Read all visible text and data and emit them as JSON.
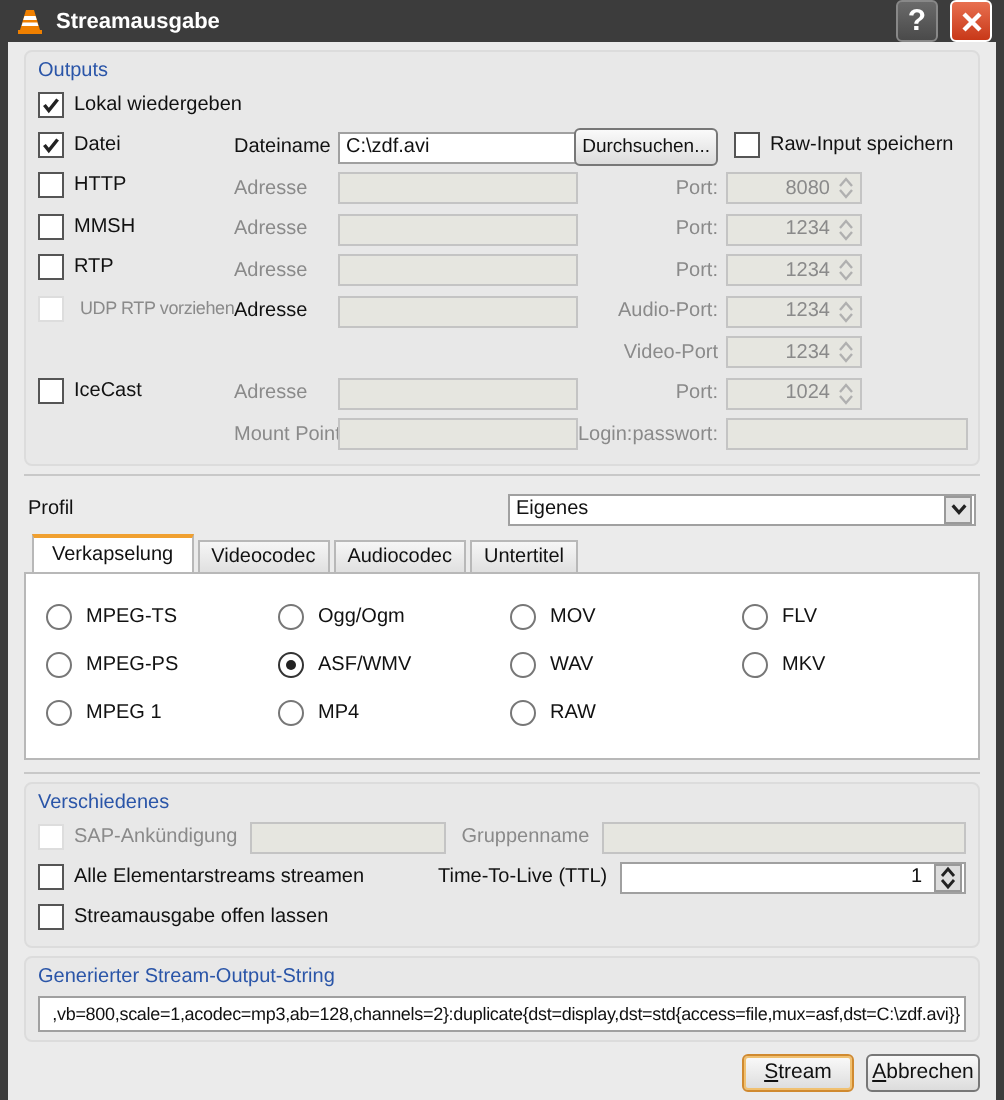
{
  "window": {
    "title": "Streamausgabe",
    "help": "?"
  },
  "outputs": {
    "title": "Outputs",
    "rows": [
      {
        "check": {
          "label": "Lokal wiedergeben",
          "checked": true,
          "disabled": false
        }
      },
      {
        "check": {
          "label": "Datei",
          "checked": true,
          "disabled": false
        },
        "label": {
          "text": "Dateiname",
          "disabled": false
        },
        "field": {
          "value": "C:\\zdf.avi",
          "disabled": false
        },
        "button": "Durchsuchen...",
        "side_check": {
          "label": "Raw-Input speichern",
          "checked": false
        }
      },
      {
        "check": {
          "label": "HTTP",
          "checked": false,
          "disabled": false
        },
        "label": {
          "text": "Adresse",
          "disabled": true
        },
        "field": {
          "disabled": true
        },
        "side_label": {
          "text": "Port:",
          "disabled": true
        },
        "spin": {
          "value": "8080",
          "disabled": true
        }
      },
      {
        "check": {
          "label": "MMSH",
          "checked": false,
          "disabled": false
        },
        "label": {
          "text": "Adresse",
          "disabled": true
        },
        "field": {
          "disabled": true
        },
        "side_label": {
          "text": "Port:",
          "disabled": true
        },
        "spin": {
          "value": "1234",
          "disabled": true
        }
      },
      {
        "check": {
          "label": "RTP",
          "checked": false,
          "disabled": false
        },
        "label": {
          "text": "Adresse",
          "disabled": true
        },
        "field": {
          "disabled": true
        },
        "side_label": {
          "text": "Port:",
          "disabled": true
        },
        "spin": {
          "value": "1234",
          "disabled": true
        }
      },
      {
        "check": {
          "label": "UDP RTP vorziehen",
          "checked": false,
          "disabled": true
        },
        "label": {
          "text": "Adresse",
          "disabled": false
        },
        "field": {
          "disabled": true
        },
        "side_label": {
          "text": "Audio-Port:",
          "disabled": true
        },
        "spin": {
          "value": "1234",
          "disabled": true
        }
      },
      {
        "side_label": {
          "text": "Video-Port",
          "disabled": true
        },
        "spin": {
          "value": "1234",
          "disabled": true
        }
      },
      {
        "check": {
          "label": "IceCast",
          "checked": false,
          "disabled": false
        },
        "label": {
          "text": "Adresse",
          "disabled": true
        },
        "field": {
          "disabled": true
        },
        "side_label": {
          "text": "Port:",
          "disabled": true
        },
        "spin": {
          "value": "1024",
          "disabled": true
        }
      },
      {
        "label": {
          "text": "Mount Point",
          "disabled": true
        },
        "field": {
          "disabled": true
        },
        "side_label": {
          "text": "Login:passwort:",
          "disabled": true
        },
        "side_field": {
          "disabled": true
        }
      }
    ]
  },
  "profile": {
    "label": "Profil",
    "value": "Eigenes"
  },
  "tabs": [
    {
      "label": "Verkapselung",
      "selected": true
    },
    {
      "label": "Videocodec",
      "selected": false
    },
    {
      "label": "Audiocodec",
      "selected": false
    },
    {
      "label": "Untertitel",
      "selected": false
    }
  ],
  "formats": [
    {
      "label": "MPEG-TS",
      "selected": false
    },
    {
      "label": "Ogg/Ogm",
      "selected": false
    },
    {
      "label": "MOV",
      "selected": false
    },
    {
      "label": "FLV",
      "selected": false
    },
    {
      "label": "MPEG-PS",
      "selected": false
    },
    {
      "label": "ASF/WMV",
      "selected": true
    },
    {
      "label": "WAV",
      "selected": false
    },
    {
      "label": "MKV",
      "selected": false
    },
    {
      "label": "MPEG 1",
      "selected": false
    },
    {
      "label": "MP4",
      "selected": false
    },
    {
      "label": "RAW",
      "selected": false
    }
  ],
  "misc": {
    "title": "Verschiedenes",
    "sap": {
      "label": "SAP-Ankündigung",
      "checked": false,
      "disabled": true
    },
    "group_label": "Gruppenname",
    "all_streams": {
      "label": "Alle Elementarstreams streamen",
      "checked": false
    },
    "ttl_label": "Time-To-Live (TTL)",
    "ttl": "1",
    "keep_open": {
      "label": "Streamausgabe offen lassen",
      "checked": false
    }
  },
  "output_string": {
    "title": "Generierter Stream-Output-String",
    "value": ",vb=800,scale=1,acodec=mp3,ab=128,channels=2}:duplicate{dst=display,dst=std{access=file,mux=asf,dst=C:\\zdf.avi}}"
  },
  "buttons": [
    {
      "label": "Stream",
      "default": true
    },
    {
      "label": "Abbrechen",
      "default": false
    }
  ]
}
